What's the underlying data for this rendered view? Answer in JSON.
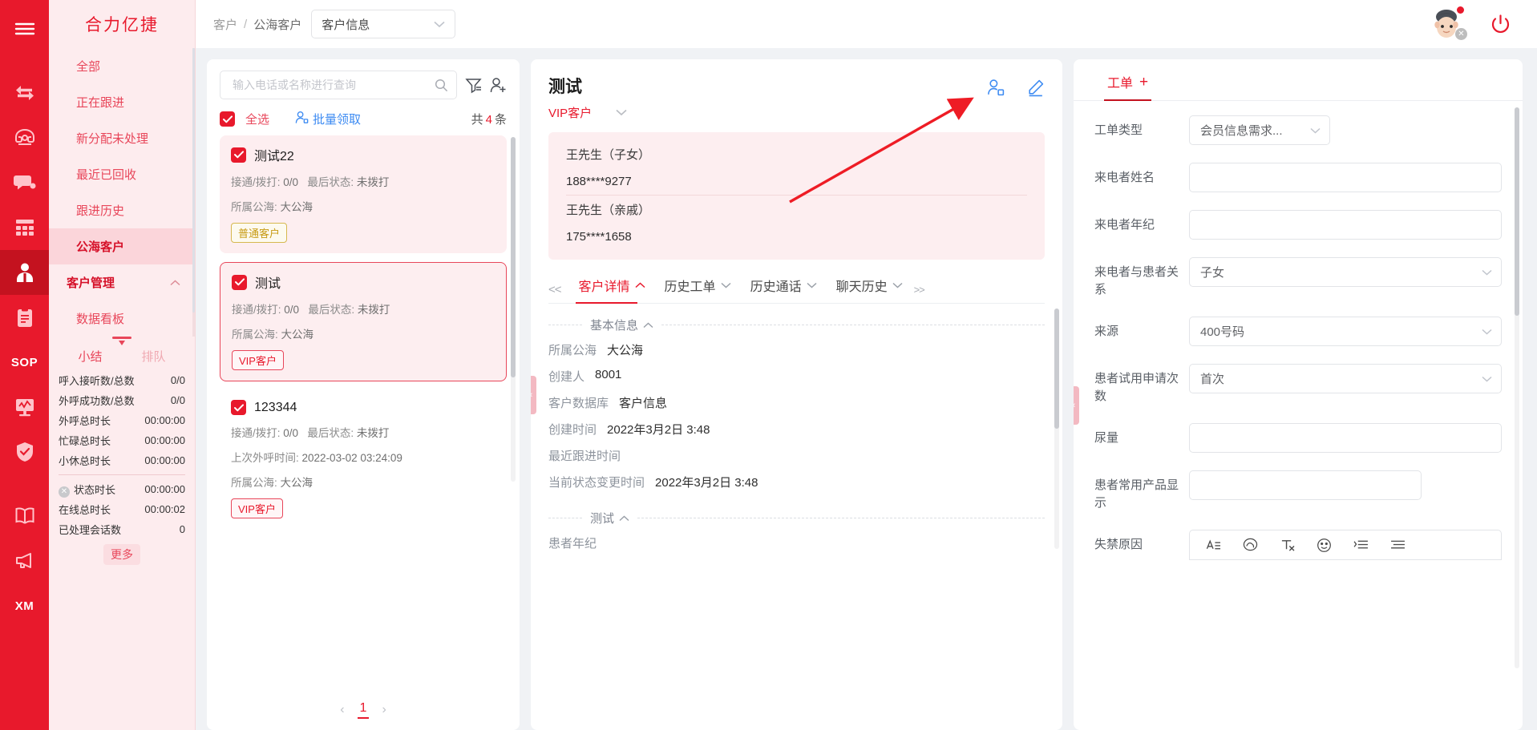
{
  "brand": {
    "title": "合力亿捷"
  },
  "rail": {
    "items": [
      {
        "name": "menu-toggle-icon",
        "label": "菜单"
      },
      {
        "name": "transfer-icon",
        "label": "转接"
      },
      {
        "name": "phone-icon",
        "label": "电话"
      },
      {
        "name": "chat-icon",
        "label": "会话"
      },
      {
        "name": "grid-icon",
        "label": "工作台"
      },
      {
        "name": "contacts-icon",
        "label": "客户"
      },
      {
        "name": "clipboard-icon",
        "label": "工单"
      },
      {
        "name": "sop-icon",
        "label": "SOP"
      },
      {
        "name": "monitor-icon",
        "label": "监控"
      },
      {
        "name": "shield-icon",
        "label": "质检"
      },
      {
        "name": "book-icon",
        "label": "知识库"
      },
      {
        "name": "megaphone-icon",
        "label": "公告"
      },
      {
        "name": "xm-icon",
        "label": "XM"
      }
    ]
  },
  "sidebar": {
    "items": [
      {
        "label": "全部",
        "selected": false
      },
      {
        "label": "正在跟进",
        "selected": false
      },
      {
        "label": "新分配未处理",
        "selected": false
      },
      {
        "label": "最近已回收",
        "selected": false
      },
      {
        "label": "跟进历史",
        "selected": false
      },
      {
        "label": "公海客户",
        "selected": true
      },
      {
        "label": "客户管理",
        "selected": false,
        "group": true
      },
      {
        "label": "数据看板",
        "selected": false
      }
    ]
  },
  "stats": {
    "tabs": [
      {
        "label": "小结",
        "active": true
      },
      {
        "label": "排队",
        "active": false
      }
    ],
    "rows": [
      {
        "label": "呼入接听数/总数",
        "value": "0/0"
      },
      {
        "label": "外呼成功数/总数",
        "value": "0/0"
      },
      {
        "label": "外呼总时长",
        "value": "00:00:00"
      },
      {
        "label": "忙碌总时长",
        "value": "00:00:00"
      },
      {
        "label": "小休总时长",
        "value": "00:00:00"
      }
    ],
    "rows2": [
      {
        "label": "状态时长",
        "value": "00:00:00",
        "icon": "status-x-icon"
      },
      {
        "label": "在线总时长",
        "value": "00:00:02",
        "icon": ""
      },
      {
        "label": "已处理会话数",
        "value": "0",
        "icon": ""
      }
    ],
    "more_label": "更多"
  },
  "topbar": {
    "breadcrumb": {
      "root": "客户",
      "sep": "/",
      "current": "公海客户"
    },
    "database_select": {
      "value": "客户信息"
    }
  },
  "list": {
    "search": {
      "placeholder": "输入电话或名称进行查询",
      "value": ""
    },
    "select_all_label": "全选",
    "batch_label": "批量领取",
    "total_prefix": "共",
    "total_count": "4",
    "total_suffix": "条",
    "items": [
      {
        "name": "测试22",
        "checked": true,
        "connect_label": "接通/拨打:",
        "connect_value": "0/0",
        "status_label": "最后状态:",
        "status_value": "未拨打",
        "last_call_label": "",
        "last_call_value": "",
        "pool_label": "所属公海:",
        "pool_value": "大公海",
        "tag": "普通客户",
        "tag_type": "normal",
        "active": false
      },
      {
        "name": "测试",
        "checked": true,
        "connect_label": "接通/拨打:",
        "connect_value": "0/0",
        "status_label": "最后状态:",
        "status_value": "未拨打",
        "last_call_label": "",
        "last_call_value": "",
        "pool_label": "所属公海:",
        "pool_value": "大公海",
        "tag": "VIP客户",
        "tag_type": "vip",
        "active": true
      },
      {
        "name": "123344",
        "checked": true,
        "connect_label": "接通/拨打:",
        "connect_value": "0/0",
        "status_label": "最后状态:",
        "status_value": "未拨打",
        "last_call_label": "上次外呼时间:",
        "last_call_value": "2022-03-02 03:24:09",
        "pool_label": "所属公海:",
        "pool_value": "大公海",
        "tag": "VIP客户",
        "tag_type": "vip",
        "active": false
      }
    ],
    "pagination": {
      "prev": "‹",
      "page": "1",
      "next": "›"
    }
  },
  "detail": {
    "name": "测试",
    "vip_label": "VIP客户",
    "contacts": [
      {
        "name": "王先生（子女）",
        "phone": "188****9277"
      },
      {
        "name": "王先生（亲戚）",
        "phone": "175****1658"
      }
    ],
    "tabs_prefix": "<<",
    "tabs_suffix": ">>",
    "tabs": [
      {
        "label": "客户详情",
        "active": true,
        "chev": "˄"
      },
      {
        "label": "历史工单",
        "active": false,
        "chev": "˅"
      },
      {
        "label": "历史通话",
        "active": false,
        "chev": "˅"
      },
      {
        "label": "聊天历史",
        "active": false,
        "chev": "˅"
      }
    ],
    "section_basic": "基本信息",
    "fields": [
      {
        "key": "所属公海",
        "value": "大公海"
      },
      {
        "key": "创建人",
        "value": "8001"
      },
      {
        "key": "客户数据库",
        "value": "客户信息"
      },
      {
        "key": "创建时间",
        "value": "2022年3月2日 3:48"
      },
      {
        "key": "最近跟进时间",
        "value": ""
      },
      {
        "key": "当前状态变更时间",
        "value": "2022年3月2日 3:48"
      }
    ],
    "section_test": "测试",
    "section_test_field": "患者年纪"
  },
  "form": {
    "tab_label": "工单",
    "tab_plus": "+",
    "fields": [
      {
        "label": "工单类型",
        "type": "select",
        "value": "会员信息需求...",
        "width": "md"
      },
      {
        "label": "来电者姓名",
        "type": "input",
        "value": ""
      },
      {
        "label": "来电者年纪",
        "type": "input",
        "value": ""
      },
      {
        "label": "来电者与患者关系",
        "type": "select",
        "value": "子女",
        "width": "full"
      },
      {
        "label": "来源",
        "type": "select",
        "value": "400号码",
        "width": "full"
      },
      {
        "label": "患者试用申请次数",
        "type": "select",
        "value": "首次",
        "width": "full"
      },
      {
        "label": "尿量",
        "type": "input",
        "value": ""
      },
      {
        "label": "患者常用产品显示",
        "type": "input",
        "value": ""
      },
      {
        "label": "失禁原因",
        "type": "richtext",
        "value": ""
      }
    ],
    "toolbar_icons": [
      "font-size-icon",
      "highlight-icon",
      "clear-format-icon",
      "emoji-icon",
      "indent-icon",
      "align-icon"
    ]
  }
}
